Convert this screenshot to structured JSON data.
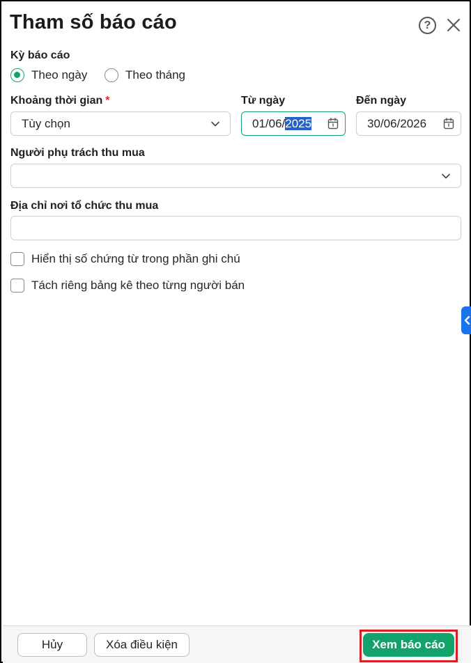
{
  "dialog": {
    "title": "Tham số báo cáo",
    "help_symbol": "?"
  },
  "period": {
    "label": "Kỳ báo cáo",
    "options": [
      {
        "label": "Theo ngày",
        "checked": true
      },
      {
        "label": "Theo tháng",
        "checked": false
      }
    ]
  },
  "time_range": {
    "label": "Khoảng thời gian",
    "required_mark": "*",
    "value": "Tùy chọn"
  },
  "from_date": {
    "label": "Từ ngày",
    "value_prefix": "01/06/",
    "value_selected": "2025"
  },
  "to_date": {
    "label": "Đến ngày",
    "value": "30/06/2026"
  },
  "purchaser": {
    "label": "Người phụ trách thu mua",
    "value": ""
  },
  "address": {
    "label": "Địa chỉ nơi tổ chức thu mua",
    "value": ""
  },
  "checkboxes": [
    {
      "label": "Hiển thị số chứng từ trong phần ghi chú",
      "checked": false
    },
    {
      "label": "Tách riêng bảng kê theo từng người bán",
      "checked": false
    }
  ],
  "footer": {
    "cancel_label": "Hủy",
    "clear_label": "Xóa điều kiện",
    "view_label": "Xem báo cáo"
  },
  "colors": {
    "accent": "#12a36b",
    "side_tab": "#1a73e8",
    "highlight": "#d81f26"
  }
}
